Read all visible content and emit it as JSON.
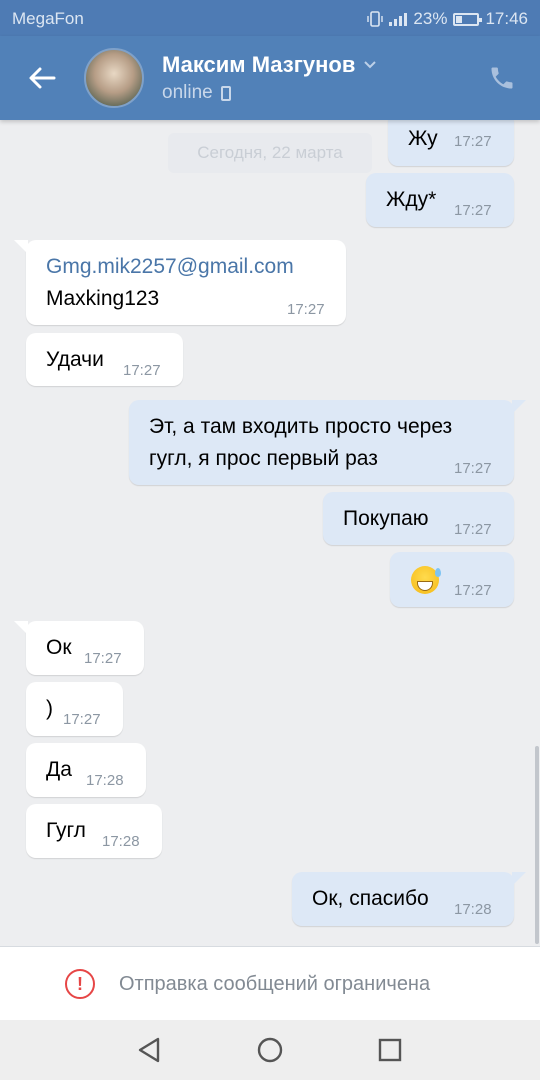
{
  "status_bar": {
    "carrier": "MegaFon",
    "battery": "23%",
    "time": "17:46"
  },
  "header": {
    "contact_name": "Максим Мазгунов",
    "presence": "online"
  },
  "date_divider": "Сегодня, 22 марта",
  "messages": [
    {
      "dir": "out",
      "lines": [
        "Жу"
      ],
      "time": "17:27"
    },
    {
      "dir": "out",
      "lines": [
        "Жду*"
      ],
      "time": "17:27"
    },
    {
      "dir": "in",
      "lines": [
        "Gmg.mik2257@gmail.com",
        "Maxking123"
      ],
      "time": "17:27"
    },
    {
      "dir": "in",
      "lines": [
        "Удачи"
      ],
      "time": "17:27"
    },
    {
      "dir": "out",
      "lines": [
        "Эт, а там входить просто через",
        "гугл, я прос первый раз"
      ],
      "time": "17:27"
    },
    {
      "dir": "out",
      "lines": [
        "Покупаю"
      ],
      "time": "17:27"
    },
    {
      "dir": "out",
      "lines": [],
      "emoji": "grinning-face-with-sweat-emoji",
      "time": "17:27"
    },
    {
      "dir": "in",
      "lines": [
        "Ок"
      ],
      "time": "17:27"
    },
    {
      "dir": "in",
      "lines": [
        ")"
      ],
      "time": "17:27"
    },
    {
      "dir": "in",
      "lines": [
        "Да"
      ],
      "time": "17:28"
    },
    {
      "dir": "in",
      "lines": [
        "Гугл"
      ],
      "time": "17:28"
    },
    {
      "dir": "out",
      "lines": [
        "Ок, спасибо"
      ],
      "time": "17:28"
    }
  ],
  "composer": {
    "notice": "Отправка сообщений ограничена",
    "icon": "warning-icon"
  },
  "colors": {
    "header": "#5181b8",
    "status_bar": "#4e7bb4",
    "out_bubble": "#dde8f6",
    "in_bubble": "#ffffff",
    "link": "#4a76a8",
    "warning": "#e64646"
  }
}
